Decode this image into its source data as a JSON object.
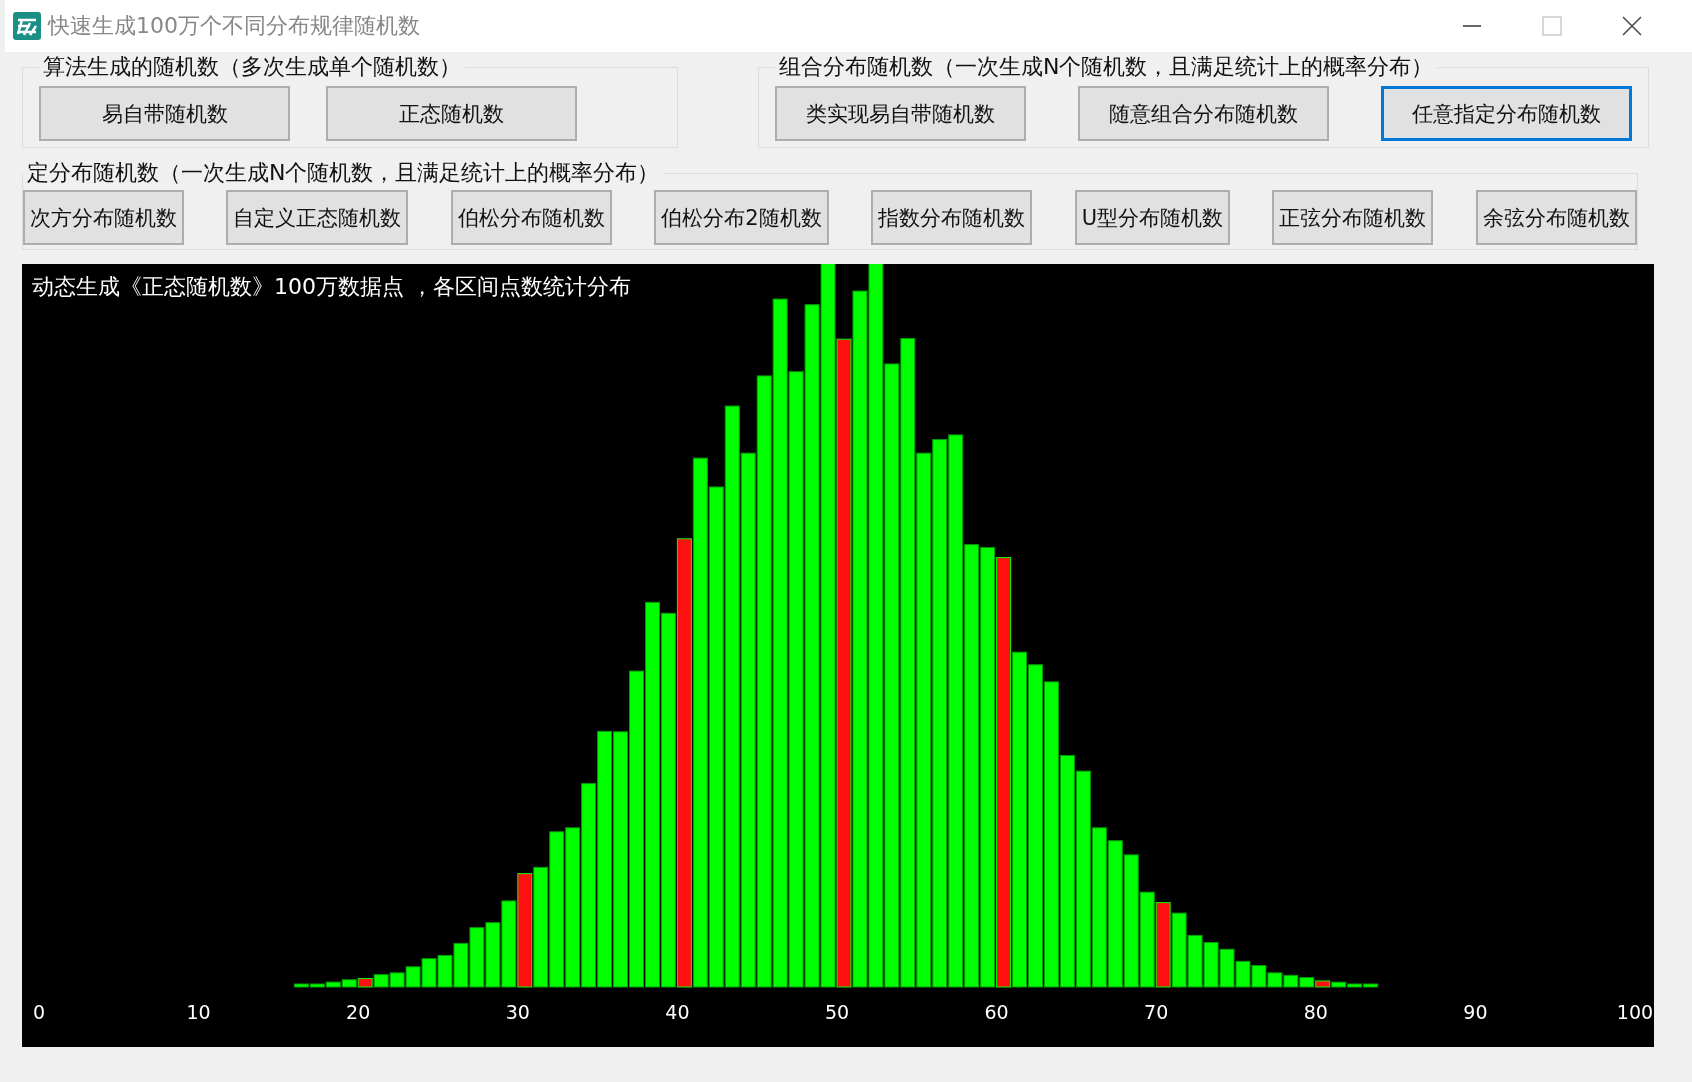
{
  "window": {
    "title": "快速生成100万个不同分布规律随机数"
  },
  "groups_top": [
    {
      "title": "算法生成的随机数（多次生成单个随机数）",
      "buttons": [
        {
          "label": "易自带随机数",
          "focused": false
        },
        {
          "label": "正态随机数",
          "focused": false
        }
      ]
    },
    {
      "title": "组合分布随机数（一次生成N个随机数，且满足统计上的概率分布）",
      "buttons": [
        {
          "label": "类实现易自带随机数",
          "focused": false
        },
        {
          "label": "随意组合分布随机数",
          "focused": false
        },
        {
          "label": "任意指定分布随机数",
          "focused": true
        }
      ]
    }
  ],
  "group_fixed": {
    "title": "定分布随机数（一次生成N个随机数，且满足统计上的概率分布）",
    "buttons": [
      {
        "label": "次方分布随机数",
        "focused": false
      },
      {
        "label": "自定义正态随机数",
        "focused": false
      },
      {
        "label": "伯松分布随机数",
        "focused": false
      },
      {
        "label": "伯松分布2随机数",
        "focused": false
      },
      {
        "label": "指数分布随机数",
        "focused": false
      },
      {
        "label": "U型分布随机数",
        "focused": false
      },
      {
        "label": "正弦分布随机数",
        "focused": false
      },
      {
        "label": "余弦分布随机数",
        "focused": false
      }
    ]
  },
  "chart": {
    "title": "动态生成《正态随机数》100万数据点 ，各区间点数统计分布",
    "axis_labels": [
      "0",
      "10",
      "20",
      "30",
      "40",
      "50",
      "60",
      "70",
      "80",
      "90",
      "100"
    ]
  }
}
